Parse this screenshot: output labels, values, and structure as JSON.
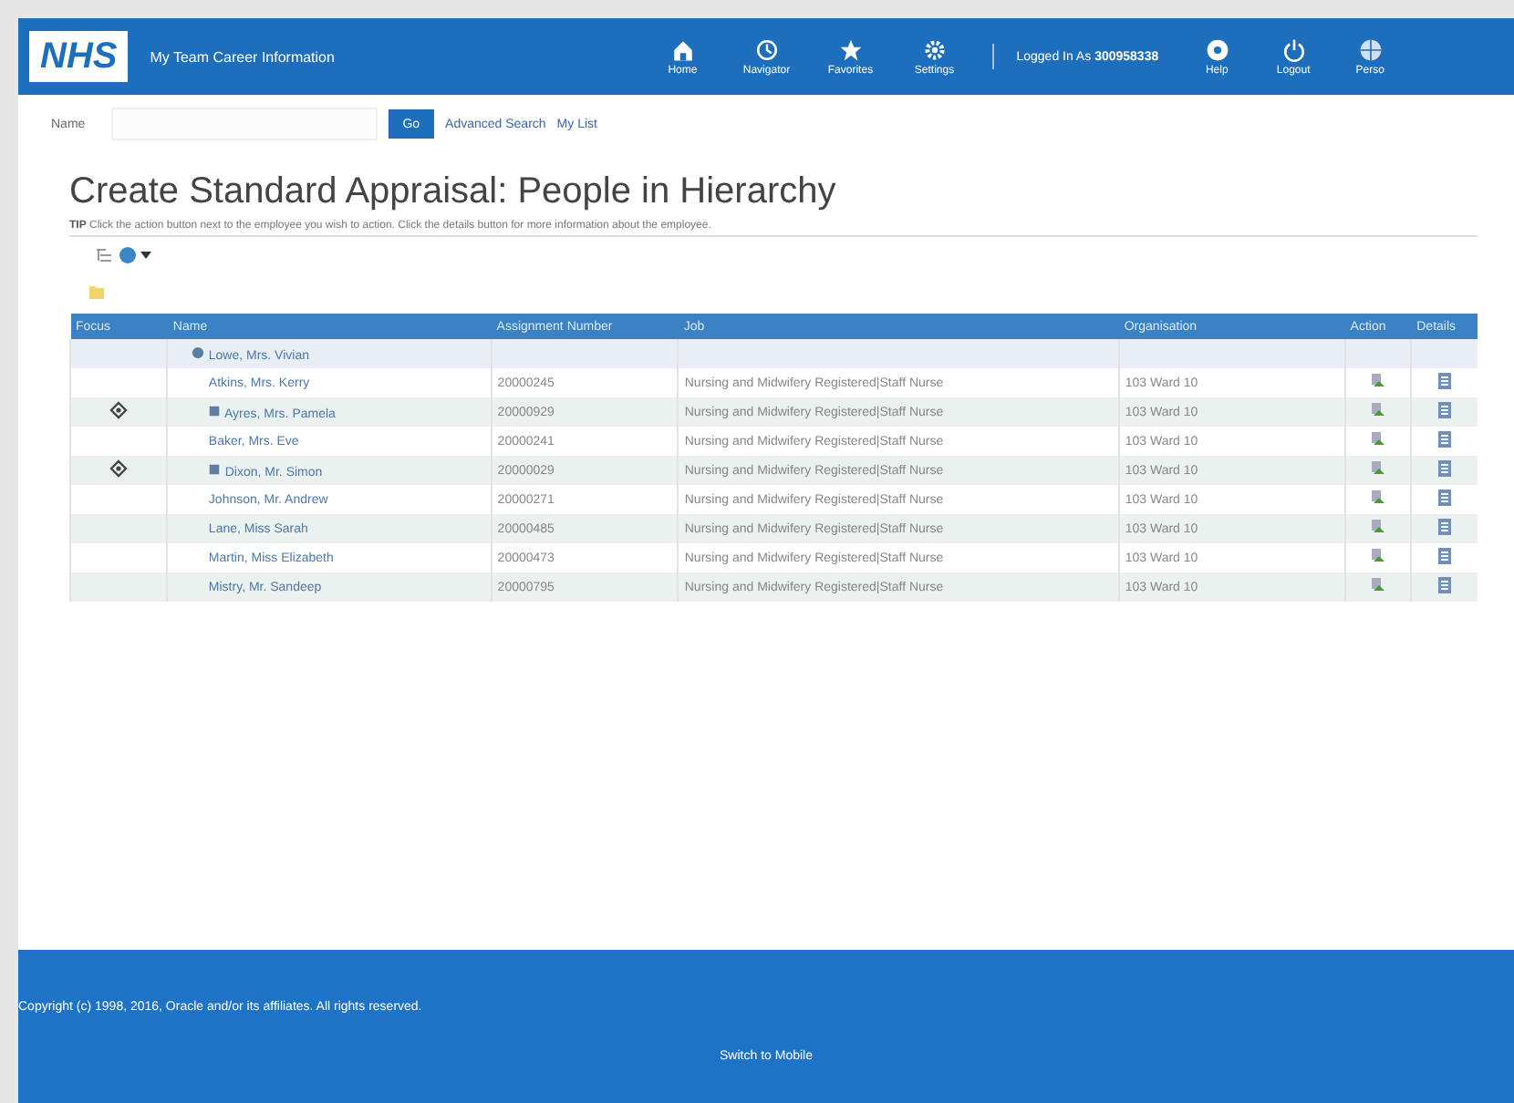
{
  "header": {
    "logo": "NHS",
    "app_title": "My Team Career Information",
    "nav": [
      {
        "label": "Home"
      },
      {
        "label": "Navigator"
      },
      {
        "label": "Favorites"
      },
      {
        "label": "Settings"
      }
    ],
    "logged_in_label": "Logged In As",
    "user": "300958338",
    "actions": [
      {
        "label": "Help"
      },
      {
        "label": "Logout"
      },
      {
        "label": "Perso"
      }
    ]
  },
  "search": {
    "label": "Name",
    "button": "Go",
    "links": [
      "Advanced Search",
      "My List"
    ]
  },
  "page_title": "Create Standard Appraisal: People in Hierarchy",
  "tip": {
    "label": "TIP",
    "text": "Click the action button next to the employee you wish to action. Click the details button for more information about the employee."
  },
  "table": {
    "columns": [
      "Focus",
      "Name",
      "Assignment Number",
      "Job",
      "Organisation",
      "Action",
      "Details"
    ],
    "root": {
      "name": "Lowe, Mrs. Vivian",
      "children": [
        {
          "name": "Atkins, Mrs. Kerry",
          "assignment": "20000245",
          "job": "Nursing and Midwifery Registered|Staff Nurse",
          "organisation": "103 Ward 10",
          "has_reports": false
        },
        {
          "name": "Ayres, Mrs. Pamela",
          "assignment": "20000929",
          "job": "Nursing and Midwifery Registered|Staff Nurse",
          "organisation": "103 Ward 10",
          "has_reports": true
        },
        {
          "name": "Baker, Mrs. Eve",
          "assignment": "20000241",
          "job": "Nursing and Midwifery Registered|Staff Nurse",
          "organisation": "103 Ward 10",
          "has_reports": false
        },
        {
          "name": "Dixon, Mr. Simon",
          "assignment": "20000029",
          "job": "Nursing and Midwifery Registered|Staff Nurse",
          "organisation": "103 Ward 10",
          "has_reports": true
        },
        {
          "name": "Johnson, Mr. Andrew",
          "assignment": "20000271",
          "job": "Nursing and Midwifery Registered|Staff Nurse",
          "organisation": "103 Ward 10",
          "has_reports": false
        },
        {
          "name": "Lane, Miss Sarah",
          "assignment": "20000485",
          "job": "Nursing and Midwifery Registered|Staff Nurse",
          "organisation": "103 Ward 10",
          "has_reports": false
        },
        {
          "name": "Martin, Miss Elizabeth",
          "assignment": "20000473",
          "job": "Nursing and Midwifery Registered|Staff Nurse",
          "organisation": "103 Ward 10",
          "has_reports": false
        },
        {
          "name": "Mistry, Mr. Sandeep",
          "assignment": "20000795",
          "job": "Nursing and Midwifery Registered|Staff Nurse",
          "organisation": "103 Ward 10",
          "has_reports": false
        }
      ]
    }
  },
  "footer": {
    "copyright": "Copyright (c) 1998, 2016, Oracle and/or its affiliates. All rights reserved.",
    "mobile_link": "Switch to Mobile"
  }
}
